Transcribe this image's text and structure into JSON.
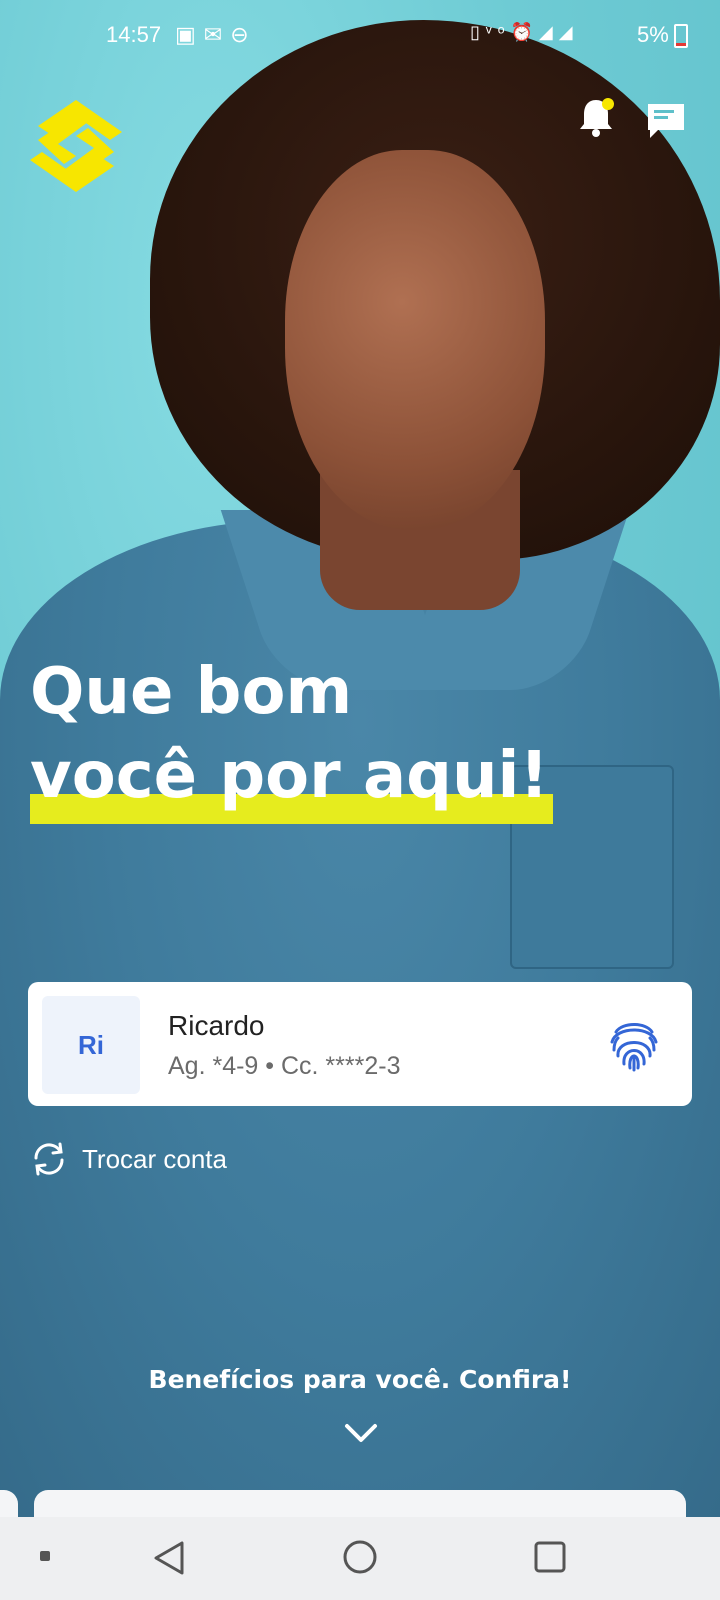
{
  "status_bar": {
    "time": "14:57",
    "left_icons": [
      "wifi-card-icon",
      "mail-icon",
      "do-not-disturb-icon"
    ],
    "right_icons": [
      "vibrate-icon",
      "volte-icon",
      "alarm-icon",
      "signal-icon",
      "4g-signal-icon"
    ],
    "battery_percent": "5%"
  },
  "header": {
    "logo": "banco-do-brasil-logo",
    "notification_badge_color": "#f7e600"
  },
  "hero": {
    "line1": "Que bom",
    "line2": "você por aqui!",
    "highlight_color": "#e6ec1e"
  },
  "account_card": {
    "avatar_initials": "Ri",
    "name": "Ricardo",
    "details": "Ag. *4-9 • Cc. ****2-3",
    "auth_icon": "fingerprint-icon"
  },
  "switch_account": {
    "label": "Trocar conta",
    "icon": "refresh-icon"
  },
  "benefits": {
    "label": "Benefícios para você. Confira!",
    "icon": "chevron-down-icon"
  },
  "colors": {
    "background": "#72cfd7",
    "avatar_text": "#3466d6",
    "logo_yellow": "#f7e600"
  }
}
